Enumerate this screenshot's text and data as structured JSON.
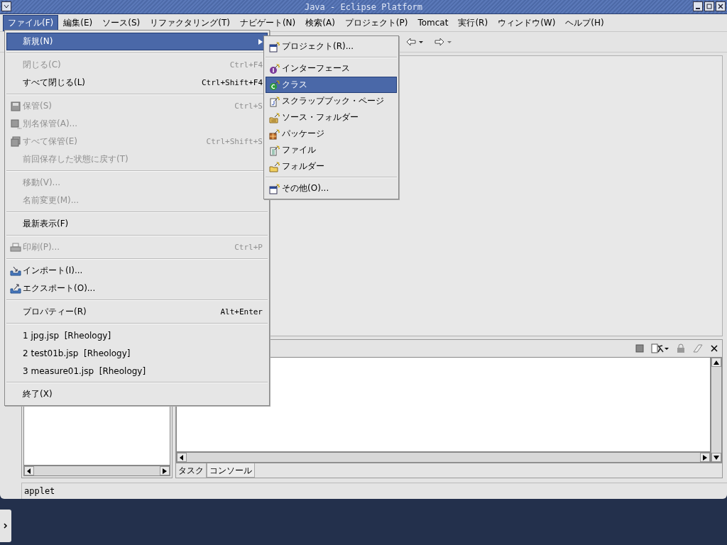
{
  "window": {
    "title": "Java - Eclipse Platform"
  },
  "menubar": [
    {
      "label": "ファイル(F)",
      "selected": true
    },
    {
      "label": "編集(E)",
      "selected": false
    },
    {
      "label": "ソース(S)",
      "selected": false
    },
    {
      "label": "リファクタリング(T)",
      "selected": false
    },
    {
      "label": "ナビゲート(N)",
      "selected": false
    },
    {
      "label": "検索(A)",
      "selected": false
    },
    {
      "label": "プロジェクト(P)",
      "selected": false
    },
    {
      "label": "Tomcat",
      "selected": false
    },
    {
      "label": "実行(R)",
      "selected": false
    },
    {
      "label": "ウィンドウ(W)",
      "selected": false
    },
    {
      "label": "ヘルプ(H)",
      "selected": false
    }
  ],
  "file_menu": [
    {
      "kind": "item",
      "label": "新規(N)",
      "selected": true,
      "disabled": false,
      "submenu": true
    },
    {
      "kind": "separator"
    },
    {
      "kind": "item",
      "label": "閉じる(C)",
      "shortcut": "Ctrl+F4",
      "selected": false,
      "disabled": true
    },
    {
      "kind": "item",
      "label": "すべて閉じる(L)",
      "shortcut": "Ctrl+Shift+F4",
      "selected": false,
      "disabled": false
    },
    {
      "kind": "separator"
    },
    {
      "kind": "item",
      "label": "保管(S)",
      "shortcut": "Ctrl+S",
      "selected": false,
      "disabled": true
    },
    {
      "kind": "item",
      "label": "別名保管(A)...",
      "selected": false,
      "disabled": true
    },
    {
      "kind": "item",
      "label": "すべて保管(E)",
      "shortcut": "Ctrl+Shift+S",
      "selected": false,
      "disabled": true
    },
    {
      "kind": "item",
      "label": "前回保存した状態に戻す(T)",
      "selected": false,
      "disabled": true
    },
    {
      "kind": "separator"
    },
    {
      "kind": "item",
      "label": "移動(V)...",
      "selected": false,
      "disabled": true
    },
    {
      "kind": "item",
      "label": "名前変更(M)...",
      "selected": false,
      "disabled": true
    },
    {
      "kind": "separator"
    },
    {
      "kind": "item",
      "label": "最新表示(F)",
      "selected": false,
      "disabled": false
    },
    {
      "kind": "separator"
    },
    {
      "kind": "item",
      "label": "印刷(P)...",
      "shortcut": "Ctrl+P",
      "selected": false,
      "disabled": true
    },
    {
      "kind": "separator"
    },
    {
      "kind": "item",
      "label": "インポート(I)...",
      "selected": false,
      "disabled": false
    },
    {
      "kind": "item",
      "label": "エクスポート(O)...",
      "selected": false,
      "disabled": false
    },
    {
      "kind": "separator"
    },
    {
      "kind": "item",
      "label": "プロパティー(R)",
      "shortcut": "Alt+Enter",
      "selected": false,
      "disabled": false
    },
    {
      "kind": "separator"
    },
    {
      "kind": "item",
      "label": "1 jpg.jsp  [Rheology]",
      "selected": false,
      "disabled": false
    },
    {
      "kind": "item",
      "label": "2 test01b.jsp  [Rheology]",
      "selected": false,
      "disabled": false
    },
    {
      "kind": "item",
      "label": "3 measure01.jsp  [Rheology]",
      "selected": false,
      "disabled": false
    },
    {
      "kind": "separator"
    },
    {
      "kind": "item",
      "label": "終了(X)",
      "selected": false,
      "disabled": false
    }
  ],
  "new_submenu": [
    {
      "kind": "item",
      "label": "プロジェクト(R)...",
      "selected": false
    },
    {
      "kind": "separator"
    },
    {
      "kind": "item",
      "label": "インターフェース",
      "selected": false
    },
    {
      "kind": "item",
      "label": "クラス",
      "selected": true
    },
    {
      "kind": "item",
      "label": "スクラップブック・ページ",
      "selected": false
    },
    {
      "kind": "item",
      "label": "ソース・フォルダー",
      "selected": false
    },
    {
      "kind": "item",
      "label": "パッケージ",
      "selected": false
    },
    {
      "kind": "item",
      "label": "ファイル",
      "selected": false
    },
    {
      "kind": "item",
      "label": "フォルダー",
      "selected": false
    },
    {
      "kind": "separator"
    },
    {
      "kind": "item",
      "label": "その他(O)...",
      "selected": false
    }
  ],
  "bottom_tabs": [
    {
      "label": "タスク",
      "selected": false
    },
    {
      "label": "コンソール",
      "selected": true
    }
  ],
  "status_bar": {
    "text": "applet"
  }
}
